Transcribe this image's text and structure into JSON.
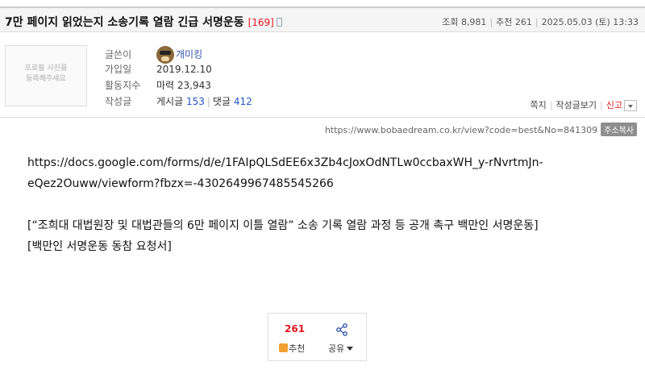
{
  "post": {
    "title": "7만 페이지 읽었는지 소송기록 열람 긴급 서명운동",
    "comment_count": "[169]",
    "meta": {
      "views": "조회 8,981",
      "recommends": "추천 261",
      "date": "2025.05.03 (토) 13:33"
    }
  },
  "profile": {
    "photo_placeholder_line1": "프로필 사진을",
    "photo_placeholder_line2": "등록해주세요",
    "author_label": "글쓴이",
    "author": "개미킹",
    "joined_label": "가입일",
    "joined": "2019.12.10",
    "activity_label": "활동지수",
    "activity": "마력 23,943",
    "posts_label": "작성글",
    "posts_text": "게시글",
    "posts_count": "153",
    "comments_text": "댓글",
    "comments_count": "412"
  },
  "tools": {
    "message": "쪽지",
    "view_posts": "작성글보기",
    "report": "신고"
  },
  "url_bar": {
    "url": "https://www.bobaedream.co.kr/view?code=best&No=841309",
    "copy_label": "주소복사"
  },
  "content": {
    "link_line1": "https://docs.google.com/forms/d/e/1FAIpQLSdEE6x3Zb4cJoxOdNTLw0ccbaxWH_y-rNvrtmJn-",
    "link_line2": "eQez2Ouww/viewform?fbzx=-4302649967485545266",
    "para1": "[“조희대 대법원장 및 대법관들의 6만 페이지 이틀 열람” 소송 기록 열람 과정 등 공개 촉구 백만인 서명운동]",
    "para2": "[백만인 서명운동 동참 요청서]"
  },
  "actions": {
    "recommend_count": "261",
    "recommend_label": "추천",
    "share_label": "공유"
  },
  "colors": {
    "accent_red": "#e4161e",
    "link_blue": "#2255cc"
  }
}
